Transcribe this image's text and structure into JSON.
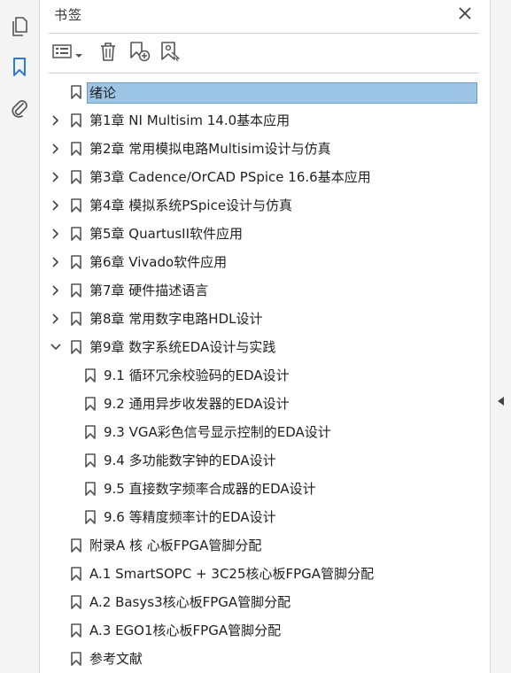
{
  "panel": {
    "title": "书签"
  },
  "rail": {
    "icons": [
      "pages-icon",
      "bookmark-icon",
      "attachment-icon"
    ],
    "accent": "#2d7ad8"
  },
  "toolbar": {
    "icons": [
      "options-menu-icon",
      "delete-icon",
      "new-bookmark-icon",
      "bookmark-from-structure-icon"
    ]
  },
  "colors": {
    "selected_bg": "#9cc4e4",
    "selected_border": "#6c9cc4"
  },
  "bookmarks": [
    {
      "label": "绪论",
      "level": 0,
      "toggle": "none",
      "selected": true
    },
    {
      "label": "第1章 NI Multisim 14.0基本应用",
      "level": 0,
      "toggle": "collapsed"
    },
    {
      "label": "第2章 常用模拟电路Multisim设计与仿真",
      "level": 0,
      "toggle": "collapsed"
    },
    {
      "label": "第3章 Cadence/OrCAD PSpice 16.6基本应用",
      "level": 0,
      "toggle": "collapsed"
    },
    {
      "label": "第4章 模拟系统PSpice设计与仿真",
      "level": 0,
      "toggle": "collapsed"
    },
    {
      "label": "第5章 QuartusII软件应用",
      "level": 0,
      "toggle": "collapsed"
    },
    {
      "label": "第6章 Vivado软件应用",
      "level": 0,
      "toggle": "collapsed"
    },
    {
      "label": "第7章 硬件描述语言",
      "level": 0,
      "toggle": "collapsed"
    },
    {
      "label": "第8章 常用数字电路HDL设计",
      "level": 0,
      "toggle": "collapsed"
    },
    {
      "label": "第9章 数字系统EDA设计与实践",
      "level": 0,
      "toggle": "expanded"
    },
    {
      "label": "9.1 循环冗余校验码的EDA设计",
      "level": 1,
      "toggle": "none"
    },
    {
      "label": "9.2 通用异步收发器的EDA设计",
      "level": 1,
      "toggle": "none"
    },
    {
      "label": "9.3 VGA彩色信号显示控制的EDA设计",
      "level": 1,
      "toggle": "none"
    },
    {
      "label": "9.4 多功能数字钟的EDA设计",
      "level": 1,
      "toggle": "none"
    },
    {
      "label": "9.5 直接数字频率合成器的EDA设计",
      "level": 1,
      "toggle": "none"
    },
    {
      "label": "9.6 等精度频率计的EDA设计",
      "level": 1,
      "toggle": "none"
    },
    {
      "label": "附录A 核 心板FPGA管脚分配",
      "level": 0,
      "toggle": "none"
    },
    {
      "label": "A.1 SmartSOPC + 3C25核心板FPGA管脚分配",
      "level": 0,
      "toggle": "none"
    },
    {
      "label": "A.2 Basys3核心板FPGA管脚分配",
      "level": 0,
      "toggle": "none"
    },
    {
      "label": "A.3 EGO1核心板FPGA管脚分配",
      "level": 0,
      "toggle": "none"
    },
    {
      "label": "参考文献",
      "level": 0,
      "toggle": "none"
    }
  ]
}
